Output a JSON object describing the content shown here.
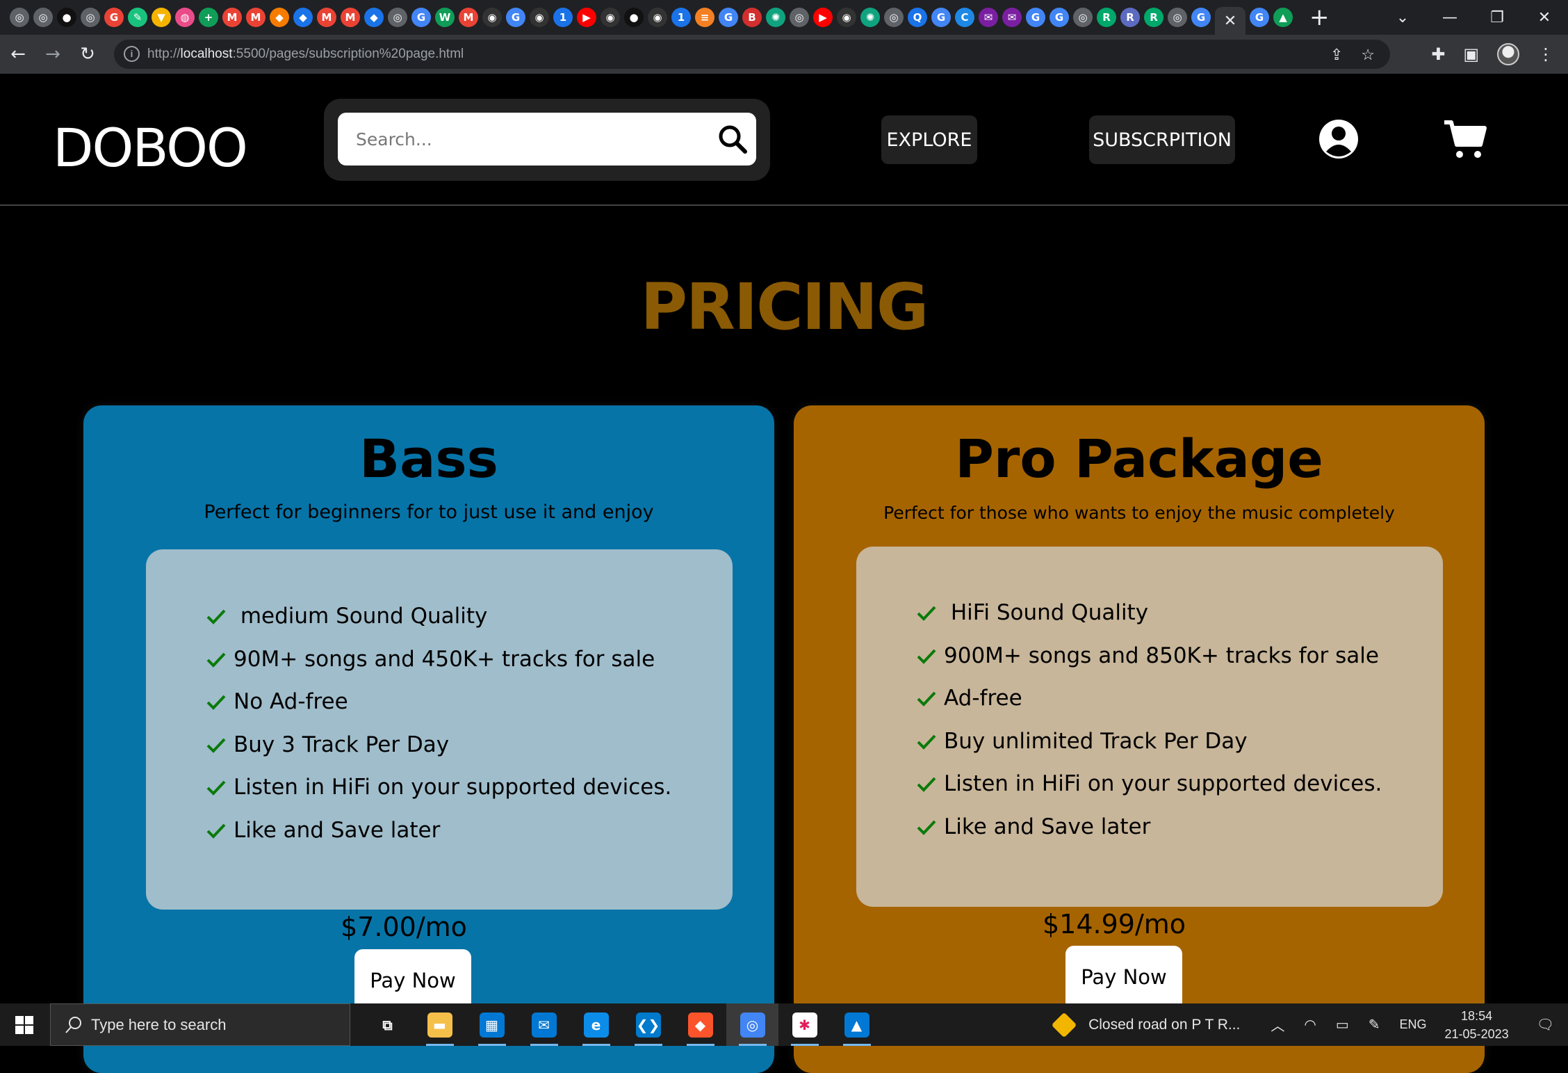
{
  "browser": {
    "tabs": [
      {
        "icon": "chrome-icon",
        "color": "#5f6368"
      },
      {
        "icon": "chrome-icon",
        "color": "#5f6368"
      },
      {
        "icon": "dark-circle-icon",
        "color": "#111111"
      },
      {
        "icon": "chrome-icon",
        "color": "#5f6368"
      },
      {
        "icon": "google-icon",
        "color": "#ea4335"
      },
      {
        "icon": "pen-icon",
        "color": "#19c37d"
      },
      {
        "icon": "shield-icon",
        "color": "#f4b400"
      },
      {
        "icon": "dribbble-icon",
        "color": "#ea4c89"
      },
      {
        "icon": "plus-icon",
        "color": "#0f9d58"
      },
      {
        "icon": "gmail-icon",
        "color": "#ea4335"
      },
      {
        "icon": "gmail-icon",
        "color": "#ea4335"
      },
      {
        "icon": "puzzle-icon",
        "color": "#f57c00"
      },
      {
        "icon": "puzzle-icon",
        "color": "#1a73e8"
      },
      {
        "icon": "gmail-icon",
        "color": "#ea4335"
      },
      {
        "icon": "gmail-icon",
        "color": "#ea4335"
      },
      {
        "icon": "puzzle-icon",
        "color": "#1a73e8"
      },
      {
        "icon": "chrome-icon",
        "color": "#5f6368"
      },
      {
        "icon": "google-icon",
        "color": "#4285f4"
      },
      {
        "icon": "w-icon",
        "color": "#0f9d58"
      },
      {
        "icon": "gmail-icon",
        "color": "#ea4335"
      },
      {
        "icon": "github-icon",
        "color": "#333333"
      },
      {
        "icon": "google-icon",
        "color": "#4285f4"
      },
      {
        "icon": "github-icon",
        "color": "#333333"
      },
      {
        "icon": "one-icon",
        "color": "#1a73e8"
      },
      {
        "icon": "youtube-icon",
        "color": "#ff0000"
      },
      {
        "icon": "github-icon",
        "color": "#333333"
      },
      {
        "icon": "dark-circle-icon",
        "color": "#111111"
      },
      {
        "icon": "github-icon",
        "color": "#333333"
      },
      {
        "icon": "one-icon",
        "color": "#1a73e8"
      },
      {
        "icon": "stackoverflow-icon",
        "color": "#f48024"
      },
      {
        "icon": "google-icon",
        "color": "#4285f4"
      },
      {
        "icon": "b-icon",
        "color": "#d32f2f"
      },
      {
        "icon": "openai-icon",
        "color": "#10a37f"
      },
      {
        "icon": "chrome-icon",
        "color": "#5f6368"
      },
      {
        "icon": "youtube-icon",
        "color": "#ff0000"
      },
      {
        "icon": "github-icon",
        "color": "#333333"
      },
      {
        "icon": "openai-icon",
        "color": "#10a37f"
      },
      {
        "icon": "chrome-icon",
        "color": "#5f6368"
      },
      {
        "icon": "search-icon",
        "color": "#1a73e8"
      },
      {
        "icon": "google-icon",
        "color": "#4285f4"
      },
      {
        "icon": "c-icon",
        "color": "#1e88e5"
      },
      {
        "icon": "chat-icon",
        "color": "#7b1fa2"
      },
      {
        "icon": "chat-icon",
        "color": "#7b1fa2"
      },
      {
        "icon": "google-icon",
        "color": "#4285f4"
      },
      {
        "icon": "google-icon",
        "color": "#4285f4"
      },
      {
        "icon": "chrome-icon",
        "color": "#5f6368"
      },
      {
        "icon": "r-icon",
        "color": "#00a86b"
      },
      {
        "icon": "r-icon",
        "color": "#5c6bc0"
      },
      {
        "icon": "r-icon",
        "color": "#00a86b"
      },
      {
        "icon": "chrome-icon",
        "color": "#5f6368"
      },
      {
        "icon": "google-icon",
        "color": "#4285f4"
      }
    ],
    "after_tabs": [
      {
        "icon": "google-icon",
        "color": "#4285f4"
      },
      {
        "icon": "drive-icon",
        "color": "#0f9d58"
      }
    ],
    "url_prefix": "http://",
    "url_host": "localhost",
    "url_rest": ":5500/pages/subscription%20page.html"
  },
  "site": {
    "logo": "DOBOO",
    "search_placeholder": "Search...",
    "nav": {
      "explore": "EXPLORE",
      "subscription": "SUBSCRPITION"
    }
  },
  "pricing": {
    "title": "PRICING",
    "title_color": "#8a5a05",
    "plans": [
      {
        "name": "Bass",
        "description": "Perfect for beginners for to just use it and enjoy",
        "features": [
          " medium Sound Quality",
          "90M+ songs and 450K+ tracks for sale",
          "No Ad-free",
          "Buy 3 Track Per Day",
          "Listen in HiFi on your supported devices.",
          "Like and Save later"
        ],
        "price": "$7.00/mo",
        "cta": "Pay Now",
        "color": "#0774a8"
      },
      {
        "name": "Pro Package",
        "description": "Perfect for those who wants to enjoy the music completely",
        "features": [
          " HiFi Sound Quality",
          "900M+ songs and 850K+ tracks for sale",
          "Ad-free",
          "Buy unlimited Track Per Day",
          "Listen in HiFi on your supported devices.",
          "Like and Save later"
        ],
        "price": "$14.99/mo",
        "cta": "Pay Now",
        "color": "#a66400"
      }
    ]
  },
  "taskbar": {
    "search_placeholder": "Type here to search",
    "apps": [
      {
        "icon": "task-view-icon",
        "color": "#1c1c1c"
      },
      {
        "icon": "file-explorer-icon",
        "color": "#f5c04a"
      },
      {
        "icon": "microsoft-store-icon",
        "color": "#0078d4"
      },
      {
        "icon": "mail-icon",
        "color": "#0078d4"
      },
      {
        "icon": "edge-icon",
        "color": "#0c8ce9"
      },
      {
        "icon": "vscode-icon",
        "color": "#007acc"
      },
      {
        "icon": "brave-icon",
        "color": "#fb542b"
      },
      {
        "icon": "chrome-icon",
        "color": "#4285f4"
      },
      {
        "icon": "slack-icon",
        "color": "#ffffff"
      },
      {
        "icon": "photos-icon",
        "color": "#0078d4"
      }
    ],
    "weather_text": "Closed road on P T R...",
    "language": "ENG",
    "time": "18:54",
    "date": "21-05-2023"
  }
}
